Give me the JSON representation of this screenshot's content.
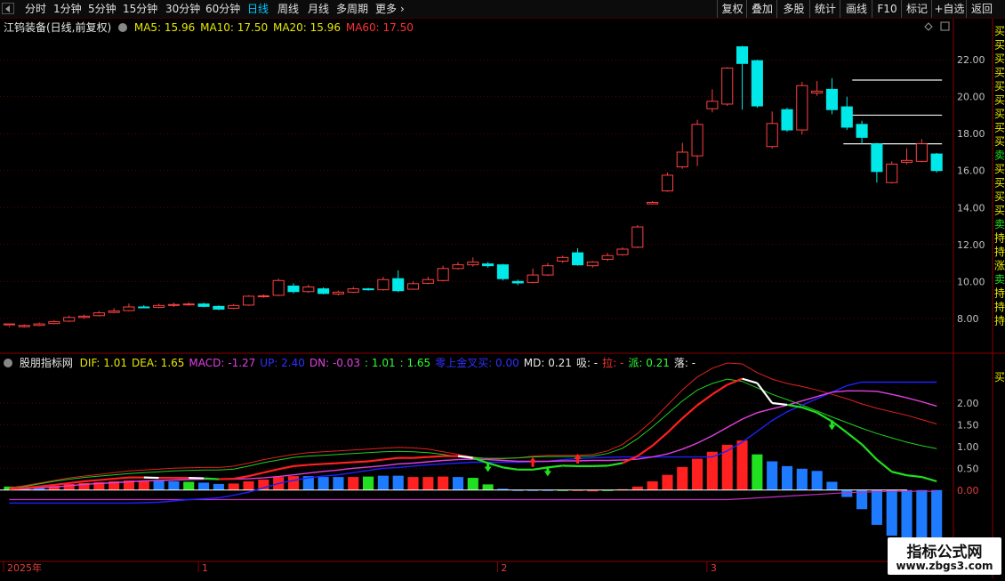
{
  "toolbar": {
    "left_items": [
      "分时",
      "1分钟",
      "5分钟",
      "15分钟",
      "30分钟",
      "60分钟",
      "日线",
      "周线",
      "月线",
      "多周期",
      "更多"
    ],
    "active_item": "日线",
    "more_arrow": "›",
    "right_items": [
      "复权",
      "叠加",
      "多股",
      "统计",
      "画线",
      "F10",
      "标记",
      "+自选",
      "返回"
    ]
  },
  "main_header": {
    "stock": "江钨装备(日线,前复权)",
    "ma5": "MA5: 15.96",
    "ma10": "MA10: 17.50",
    "ma20": "MA20: 15.96",
    "ma60": "MA60: 17.50"
  },
  "indicator_header": {
    "name": "股朋指标网",
    "items": [
      {
        "text": "DIF: 1.01",
        "color": "#e8e800"
      },
      {
        "text": "DEA: 1.65",
        "color": "#e8e800"
      },
      {
        "text": "MACD: -1.27",
        "color": "#e040e0"
      },
      {
        "text": "UP: 2.40",
        "color": "#3030ff"
      },
      {
        "text": "DN: -0.03",
        "color": "#e040e0"
      },
      {
        "text": ": 1.01",
        "color": "#30ff30"
      },
      {
        "text": ": 1.65",
        "color": "#30ff30"
      },
      {
        "text": "零上金叉买: 0.00",
        "color": "#3030ff"
      },
      {
        "text": "MD: 0.21",
        "color": "#e8e8e8"
      },
      {
        "text": "吸: -",
        "color": "#e8e8e8"
      },
      {
        "text": "拉: -",
        "color": "#ff3030"
      },
      {
        "text": "派: 0.21",
        "color": "#30ff30"
      },
      {
        "text": "落: -",
        "color": "#e8e8e8"
      }
    ]
  },
  "price_axis": {
    "labels": [
      "22.00",
      "20.00",
      "18.00",
      "16.00",
      "14.00",
      "12.00",
      "10.00",
      "8.00"
    ],
    "min": 6.5,
    "max": 23.5
  },
  "macd_axis": {
    "labels": [
      "2.00",
      "1.50",
      "1.00",
      "0.50",
      "0.00"
    ],
    "min": -1.6,
    "max": 2.9
  },
  "right_edge_text": "买买买买买买买买买卖买买买买卖持持涨卖持持持",
  "right_edge_bottom": "买",
  "date_labels": [
    {
      "text": "2025年",
      "index": 0
    },
    {
      "text": "1",
      "index": 13
    },
    {
      "text": "2",
      "index": 33
    },
    {
      "text": "3",
      "index": 47
    }
  ],
  "resistance_levels": [
    20.9,
    19.0,
    17.45
  ],
  "chart_data": {
    "type": "candlestick",
    "ohlc": [
      [
        7.65,
        7.7,
        7.58,
        7.52
      ],
      [
        7.55,
        7.62,
        7.68,
        7.5
      ],
      [
        7.62,
        7.7,
        7.78,
        7.58
      ],
      [
        7.72,
        7.82,
        7.9,
        7.68
      ],
      [
        7.85,
        8.05,
        8.15,
        7.8
      ],
      [
        8.05,
        8.12,
        8.2,
        7.98
      ],
      [
        8.15,
        8.3,
        8.4,
        8.1
      ],
      [
        8.32,
        8.4,
        8.55,
        8.28
      ],
      [
        8.42,
        8.62,
        8.8,
        8.38
      ],
      [
        8.62,
        8.6,
        8.72,
        8.55
      ],
      [
        8.6,
        8.7,
        8.8,
        8.55
      ],
      [
        8.7,
        8.75,
        8.85,
        8.62
      ],
      [
        8.75,
        8.78,
        8.88,
        8.68
      ],
      [
        8.78,
        8.65,
        8.85,
        8.6
      ],
      [
        8.65,
        8.5,
        8.7,
        8.45
      ],
      [
        8.55,
        8.7,
        8.78,
        8.5
      ],
      [
        8.72,
        9.2,
        9.25,
        8.68
      ],
      [
        9.2,
        9.22,
        9.3,
        9.12
      ],
      [
        9.25,
        10.05,
        10.15,
        9.2
      ],
      [
        9.75,
        9.45,
        9.9,
        9.35
      ],
      [
        9.45,
        9.7,
        9.82,
        9.38
      ],
      [
        9.6,
        9.35,
        9.68,
        9.3
      ],
      [
        9.32,
        9.42,
        9.5,
        9.25
      ],
      [
        9.42,
        9.6,
        9.7,
        9.38
      ],
      [
        9.6,
        9.55,
        9.65,
        9.5
      ],
      [
        9.55,
        10.1,
        10.25,
        9.5
      ],
      [
        10.15,
        9.5,
        10.6,
        9.42
      ],
      [
        9.58,
        9.88,
        10.02,
        9.55
      ],
      [
        9.9,
        10.1,
        10.25,
        9.85
      ],
      [
        10.05,
        10.7,
        10.85,
        10.0
      ],
      [
        10.7,
        10.9,
        11.05,
        10.65
      ],
      [
        10.9,
        11.05,
        11.3,
        10.8
      ],
      [
        10.95,
        10.85,
        11.05,
        10.75
      ],
      [
        10.9,
        10.15,
        10.95,
        10.05
      ],
      [
        10.0,
        9.92,
        10.1,
        9.8
      ],
      [
        9.95,
        10.35,
        10.7,
        9.9
      ],
      [
        10.35,
        10.85,
        11.0,
        10.3
      ],
      [
        11.1,
        11.3,
        11.4,
        11.0
      ],
      [
        11.55,
        10.9,
        11.8,
        10.85
      ],
      [
        10.85,
        11.05,
        11.1,
        10.75
      ],
      [
        11.2,
        11.4,
        11.55,
        11.1
      ],
      [
        11.45,
        11.75,
        11.85,
        11.4
      ],
      [
        11.85,
        12.95,
        13.05,
        11.8
      ],
      [
        14.2,
        14.28,
        14.35,
        14.2
      ],
      [
        14.9,
        15.75,
        15.9,
        14.85
      ],
      [
        16.2,
        17.0,
        17.5,
        16.1
      ],
      [
        16.8,
        18.5,
        18.75,
        16.25
      ],
      [
        19.35,
        19.75,
        20.4,
        19.15
      ],
      [
        19.6,
        21.55,
        21.6,
        19.5
      ],
      [
        22.7,
        21.8,
        22.75,
        19.3
      ],
      [
        21.95,
        19.5,
        22.0,
        19.4
      ],
      [
        17.3,
        18.55,
        19.2,
        17.2
      ],
      [
        19.3,
        18.2,
        19.4,
        18.1
      ],
      [
        18.2,
        20.6,
        20.8,
        17.95
      ],
      [
        20.2,
        20.3,
        20.85,
        20.05
      ],
      [
        20.4,
        19.3,
        21.0,
        19.05
      ],
      [
        19.45,
        18.35,
        20.0,
        18.2
      ],
      [
        18.5,
        17.8,
        18.7,
        17.45
      ],
      [
        17.45,
        15.95,
        17.5,
        15.35
      ],
      [
        15.35,
        16.35,
        16.5,
        15.3
      ],
      [
        16.45,
        16.55,
        17.2,
        16.35
      ],
      [
        16.5,
        17.45,
        17.7,
        16.45
      ],
      [
        16.9,
        16.0,
        16.95,
        15.9
      ]
    ],
    "macd_hist": [
      0.08,
      0.06,
      0.07,
      0.1,
      0.14,
      0.16,
      0.18,
      0.2,
      0.22,
      0.22,
      0.21,
      0.2,
      0.19,
      0.17,
      0.14,
      0.15,
      0.2,
      0.24,
      0.3,
      0.32,
      0.32,
      0.3,
      0.3,
      0.3,
      0.31,
      0.33,
      0.33,
      0.3,
      0.3,
      0.31,
      0.3,
      0.28,
      0.13,
      0.03,
      0.0,
      -0.02,
      -0.02,
      0.0,
      0.0,
      -0.03,
      0.0,
      0.02,
      0.08,
      0.2,
      0.35,
      0.53,
      0.72,
      0.88,
      1.04,
      1.14,
      0.82,
      0.66,
      0.55,
      0.49,
      0.44,
      0.19,
      -0.16,
      -0.44,
      -0.8,
      -1.05,
      -1.32,
      -1.36,
      -1.25
    ],
    "hist_colors": [
      "G",
      "B",
      "B",
      "R",
      "R",
      "R",
      "R",
      "R",
      "R",
      "R",
      "B",
      "B",
      "G",
      "B",
      "B",
      "R",
      "R",
      "R",
      "R",
      "R",
      "B",
      "B",
      "B",
      "R",
      "G",
      "B",
      "B",
      "R",
      "R",
      "R",
      "B",
      "G",
      "G",
      "B",
      "B",
      "B",
      "B",
      "G",
      "R",
      "R",
      "G",
      "R",
      "R",
      "R",
      "R",
      "R",
      "R",
      "R",
      "R",
      "R",
      "G",
      "B",
      "B",
      "B",
      "B",
      "B",
      "B",
      "B",
      "B",
      "B",
      "B",
      "B",
      "B"
    ],
    "dif": [
      0.02,
      0.05,
      0.08,
      0.12,
      0.16,
      0.2,
      0.23,
      0.26,
      0.29,
      0.29,
      0.28,
      0.28,
      0.28,
      0.27,
      0.25,
      0.26,
      0.32,
      0.4,
      0.48,
      0.55,
      0.58,
      0.6,
      0.62,
      0.64,
      0.66,
      0.7,
      0.74,
      0.74,
      0.76,
      0.78,
      0.78,
      0.74,
      0.62,
      0.52,
      0.47,
      0.47,
      0.52,
      0.56,
      0.55,
      0.55,
      0.56,
      0.62,
      0.78,
      1.02,
      1.32,
      1.65,
      1.95,
      2.2,
      2.42,
      2.56,
      2.46,
      2.0,
      1.96,
      1.9,
      1.78,
      1.58,
      1.32,
      1.05,
      0.7,
      0.42,
      0.34,
      0.3,
      0.2
    ],
    "dea": [
      0.02,
      0.03,
      0.05,
      0.07,
      0.1,
      0.13,
      0.15,
      0.17,
      0.19,
      0.21,
      0.22,
      0.23,
      0.24,
      0.25,
      0.25,
      0.25,
      0.26,
      0.28,
      0.31,
      0.35,
      0.39,
      0.43,
      0.46,
      0.5,
      0.53,
      0.56,
      0.6,
      0.62,
      0.65,
      0.68,
      0.7,
      0.71,
      0.7,
      0.68,
      0.66,
      0.66,
      0.66,
      0.67,
      0.67,
      0.68,
      0.68,
      0.69,
      0.71,
      0.76,
      0.83,
      0.94,
      1.08,
      1.25,
      1.44,
      1.63,
      1.78,
      1.87,
      1.95,
      2.05,
      2.15,
      2.25,
      2.28,
      2.28,
      2.27,
      2.2,
      2.12,
      2.03,
      1.93
    ],
    "upper1": [
      0.05,
      0.1,
      0.16,
      0.22,
      0.28,
      0.32,
      0.36,
      0.4,
      0.44,
      0.46,
      0.48,
      0.5,
      0.51,
      0.52,
      0.52,
      0.55,
      0.62,
      0.7,
      0.76,
      0.82,
      0.86,
      0.88,
      0.9,
      0.92,
      0.94,
      0.96,
      0.98,
      0.97,
      0.94,
      0.88,
      0.82,
      0.76,
      0.72,
      0.72,
      0.74,
      0.78,
      0.8,
      0.8,
      0.8,
      0.82,
      0.9,
      1.05,
      1.3,
      1.6,
      1.95,
      2.3,
      2.6,
      2.8,
      2.92,
      2.9,
      2.7,
      2.55,
      2.45,
      2.38,
      2.3,
      2.2,
      2.1,
      1.98,
      1.88,
      1.8,
      1.72,
      1.62,
      1.52
    ],
    "upper2": [
      0.03,
      0.08,
      0.14,
      0.2,
      0.25,
      0.29,
      0.32,
      0.35,
      0.38,
      0.4,
      0.42,
      0.44,
      0.45,
      0.46,
      0.46,
      0.48,
      0.55,
      0.63,
      0.69,
      0.75,
      0.78,
      0.8,
      0.82,
      0.84,
      0.86,
      0.88,
      0.89,
      0.88,
      0.86,
      0.82,
      0.77,
      0.74,
      0.73,
      0.73,
      0.74,
      0.76,
      0.77,
      0.77,
      0.77,
      0.78,
      0.84,
      0.96,
      1.18,
      1.45,
      1.75,
      2.05,
      2.3,
      2.45,
      2.55,
      2.5,
      2.35,
      2.2,
      2.08,
      1.95,
      1.82,
      1.68,
      1.55,
      1.42,
      1.3,
      1.2,
      1.1,
      1.02,
      0.95
    ],
    "up_line": [
      -0.3,
      -0.3,
      -0.3,
      -0.3,
      -0.3,
      -0.3,
      -0.3,
      -0.3,
      -0.3,
      -0.29,
      -0.28,
      -0.25,
      -0.22,
      -0.2,
      -0.18,
      -0.12,
      -0.05,
      0.05,
      0.15,
      0.22,
      0.28,
      0.32,
      0.35,
      0.4,
      0.45,
      0.5,
      0.52,
      0.55,
      0.58,
      0.6,
      0.62,
      0.64,
      0.64,
      0.64,
      0.64,
      0.65,
      0.66,
      0.7,
      0.72,
      0.74,
      0.75,
      0.76,
      0.76,
      0.76,
      0.76,
      0.76,
      0.76,
      0.76,
      0.9,
      1.1,
      1.35,
      1.6,
      1.8,
      1.95,
      2.1,
      2.25,
      2.4,
      2.48,
      2.48,
      2.48,
      2.48,
      2.48,
      2.48
    ],
    "dn_line": [
      -0.22,
      -0.22,
      -0.22,
      -0.22,
      -0.22,
      -0.22,
      -0.22,
      -0.22,
      -0.22,
      -0.22,
      -0.22,
      -0.22,
      -0.22,
      -0.22,
      -0.22,
      -0.22,
      -0.22,
      -0.22,
      -0.22,
      -0.22,
      -0.22,
      -0.22,
      -0.22,
      -0.22,
      -0.22,
      -0.22,
      -0.22,
      -0.22,
      -0.22,
      -0.22,
      -0.22,
      -0.22,
      -0.22,
      -0.22,
      -0.22,
      -0.22,
      -0.22,
      -0.22,
      -0.22,
      -0.22,
      -0.22,
      -0.22,
      -0.22,
      -0.22,
      -0.22,
      -0.22,
      -0.22,
      -0.22,
      -0.22,
      -0.2,
      -0.18,
      -0.16,
      -0.14,
      -0.12,
      -0.1,
      -0.08,
      -0.06,
      -0.05,
      -0.04,
      -0.03,
      -0.03,
      -0.03,
      -0.03
    ],
    "up_arrows": [
      35,
      38,
      38
    ],
    "down_arrows": [
      32,
      36,
      55
    ]
  }
}
